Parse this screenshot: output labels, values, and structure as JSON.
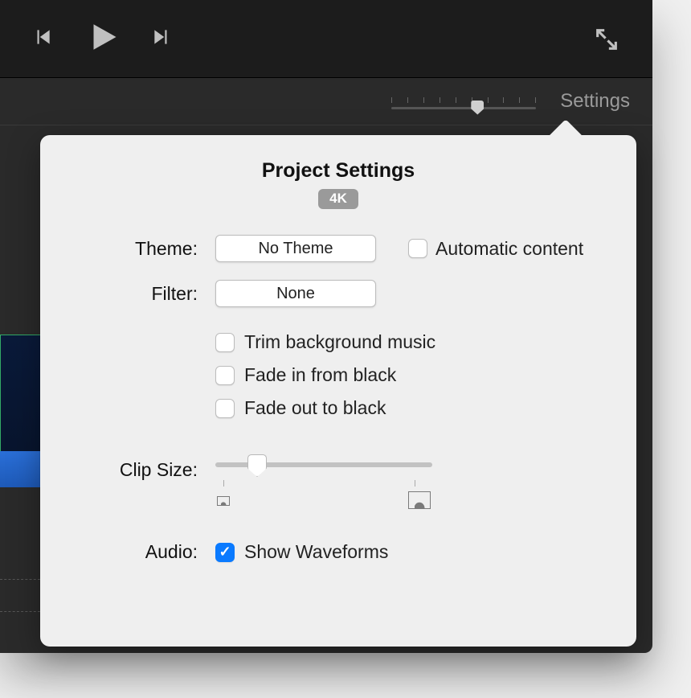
{
  "toolbar": {
    "settings_label": "Settings"
  },
  "timeline": {
    "zoom_value_pct": 57
  },
  "popover": {
    "title": "Project Settings",
    "badge": "4K",
    "theme_label": "Theme:",
    "theme_value": "No Theme",
    "automatic_content_label": "Automatic content",
    "automatic_content_checked": false,
    "filter_label": "Filter:",
    "filter_value": "None",
    "trim_bg_label": "Trim background music",
    "trim_bg_checked": false,
    "fade_in_label": "Fade in from black",
    "fade_in_checked": false,
    "fade_out_label": "Fade out to black",
    "fade_out_checked": false,
    "clip_size_label": "Clip Size:",
    "clip_size_value_pct": 16,
    "audio_label": "Audio:",
    "show_waveforms_label": "Show Waveforms",
    "show_waveforms_checked": true
  }
}
